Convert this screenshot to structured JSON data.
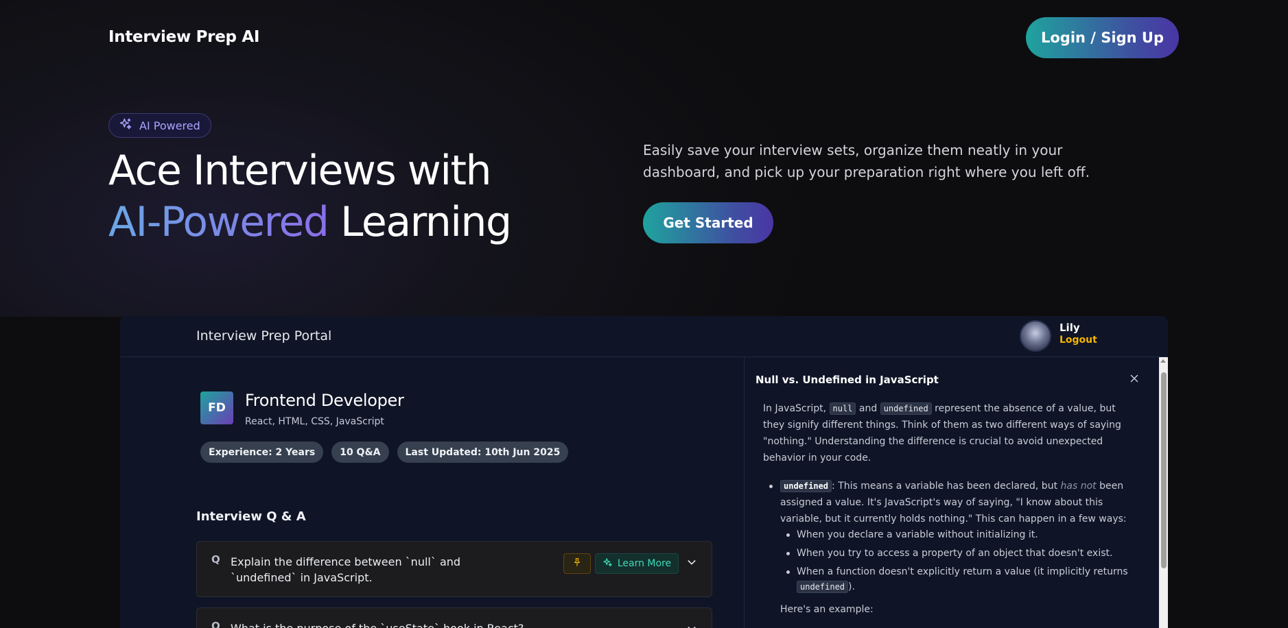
{
  "hero": {
    "brand": "Interview Prep AI",
    "login_label": "Login / Sign Up",
    "badge_label": "AI Powered",
    "title_line1": "Ace Interviews with",
    "title_highlight": "AI-Powered",
    "title_rest": " Learning",
    "description": "Easily save your interview sets, organize them neatly in your dashboard, and pick up your preparation right where you left off.",
    "cta_label": "Get Started"
  },
  "portal": {
    "title": "Interview Prep Portal",
    "user_name": "Lily",
    "logout_label": "Logout"
  },
  "session": {
    "initials": "FD",
    "role": "Frontend Developer",
    "topics": "React, HTML, CSS, JavaScript",
    "pills": [
      "Experience: 2 Years",
      "10 Q&A",
      "Last Updated: 10th Jun 2025"
    ]
  },
  "qa": {
    "heading": "Interview Q & A",
    "q_marker": "Q",
    "learn_more_label": "Learn More",
    "items": [
      "Explain the difference between `null` and `undefined` in JavaScript.",
      "What is the purpose of the `useState` hook in React?"
    ]
  },
  "drawer": {
    "title": "Null vs. Undefined in JavaScript",
    "intro_1": "In JavaScript, ",
    "code_null": "null",
    "intro_2": " and ",
    "code_undefined": "undefined",
    "intro_3": " represent the absence of a value, but they signify different things. Think of them as two different ways of saying \"nothing.\" Understanding the difference is crucial to avoid unexpected behavior in your code.",
    "bullet_code": "undefined",
    "bullet_1": ": This means a variable has been declared, but ",
    "bullet_em": "has not",
    "bullet_2": " been assigned a value. It's JavaScript's way of saying, \"I know about this variable, but it currently holds nothing.\" This can happen in a few ways:",
    "sub_items": [
      "When you declare a variable without initializing it.",
      "When you try to access a property of an object that doesn't exist.",
      "When a function doesn't explicitly return a value (it implicitly returns "
    ],
    "sub_code": "undefined",
    "sub_end": ").",
    "example": "Here's an example:"
  },
  "colors": {
    "accent_teal": "#1fa39e",
    "accent_purple": "#4a35a5",
    "logout": "#f5b400",
    "learn_more": "#3fd9b8"
  },
  "icons": [
    "sparkle-icon",
    "pin-icon",
    "chevron-down-icon",
    "close-icon"
  ]
}
